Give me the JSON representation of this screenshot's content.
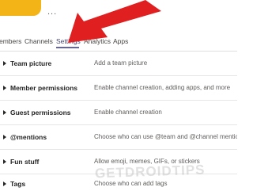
{
  "header": {
    "more_label": "..."
  },
  "tabs": [
    {
      "label": "embers",
      "active": false
    },
    {
      "label": "Channels",
      "active": false
    },
    {
      "label": "Settings",
      "active": true
    },
    {
      "label": "Analytics",
      "active": false
    },
    {
      "label": "Apps",
      "active": false
    }
  ],
  "settings": [
    {
      "title": "Team picture",
      "description": "Add a team picture"
    },
    {
      "title": "Member permissions",
      "description": "Enable channel creation, adding apps, and more"
    },
    {
      "title": "Guest permissions",
      "description": "Enable channel creation"
    },
    {
      "title": "@mentions",
      "description": "Choose who can use @team and @channel mentions"
    },
    {
      "title": "Fun stuff",
      "description": "Allow emoji, memes, GIFs, or stickers"
    },
    {
      "title": "Tags",
      "description": "Choose who can add tags"
    }
  ],
  "watermark": "GETDROIDTIPS",
  "colors": {
    "accent": "#6264a7",
    "avatar": "#f2b417",
    "annotation_arrow": "#e02020"
  }
}
